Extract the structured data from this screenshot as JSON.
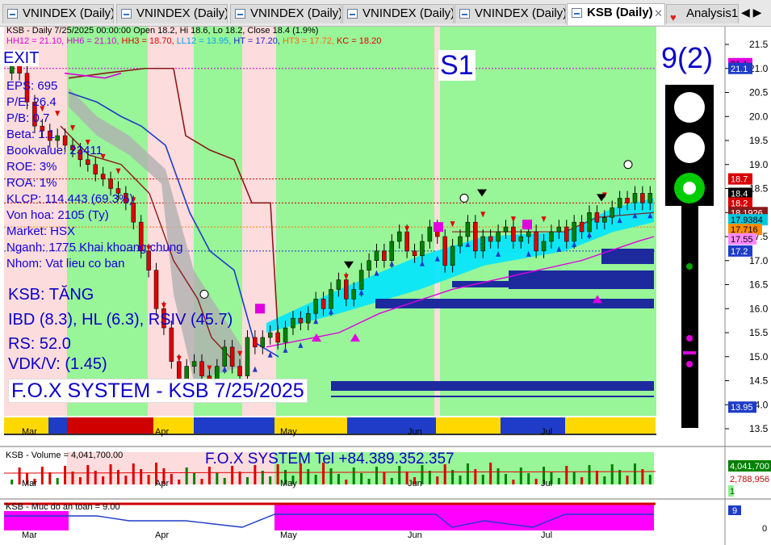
{
  "tabs": [
    {
      "label": "VNINDEX (Daily)",
      "active": false
    },
    {
      "label": "VNINDEX (Daily)",
      "active": false
    },
    {
      "label": "VNINDEX (Daily)",
      "active": false
    },
    {
      "label": "VNINDEX (Daily)",
      "active": false
    },
    {
      "label": "VNINDEX (Daily)",
      "active": false
    },
    {
      "label": "KSB (Daily)",
      "active": true
    },
    {
      "label": "Analysis1",
      "active": false
    }
  ],
  "tab_close": "✕",
  "tab_nav": "◀ ▶",
  "header": {
    "title": "KSB - Daily 7/25/2025 00:00:00 Open 18.2, Hi 18.6, Lo 18.2, Close 18.4 (1.9%)",
    "hh12": "HH12 = 21.10,",
    "hh6": "HH6 = 21.10,",
    "hh3": "HH3 = 18.70,",
    "ll12": "LL12 = 13.95,",
    "ht": "HT  = 17.20,",
    "ht3": "HT3  = 17.72,",
    "kc": "KC = 18.20"
  },
  "overlay": {
    "exit": "EXIT",
    "s1": "S1",
    "signal": "9(2)",
    "eps": "EPS: 695",
    "pe": "P/E: 26.4",
    "pb": "P/B: 0.7",
    "beta": "Beta: 1.1",
    "bookvalue": "Bookvalue: 23411",
    "roe": "ROE: 3%",
    "roa": "ROA: 1%",
    "klcp": "KLCP: 114.443 (69.3%)",
    "vonhoa": "Von hoa: 2105 (Ty)",
    "market": "Market: HSX",
    "nganh": "Nganh: 1775 Khai khoang chung",
    "nhom": "Nhom: Vat lieu co ban",
    "trend": "KSB: TĂNG",
    "ibd": "IBD (8.3), HL (6.3), RSIV (45.7)",
    "rs": "RS: 52.0",
    "vdk": "VDK/V:  (1.45)",
    "fox_title": "F.O.X SYSTEM - KSB 7/25/2025"
  },
  "price_axis": {
    "ticks": [
      "21.5",
      "21.0",
      "20.5",
      "20.0",
      "19.5",
      "19.0",
      "18.5",
      "18.0",
      "17.5",
      "17.0",
      "16.5",
      "16.0",
      "15.5",
      "15.0",
      "14.5",
      "14.0",
      "13.5"
    ],
    "labels": [
      {
        "text": "21.1",
        "bg": "#e000e0",
        "fg": "#000000",
        "price": 21.1
      },
      {
        "text": "21.1",
        "bg": "#1e3cc8",
        "fg": "#ffffff",
        "price": 21.0
      },
      {
        "text": "18.7",
        "bg": "#d80000",
        "fg": "#ffffff",
        "price": 18.7
      },
      {
        "text": "18.4",
        "bg": "#000000",
        "fg": "#ffffff",
        "price": 18.4
      },
      {
        "text": "18.2",
        "bg": "#d80000",
        "fg": "#ffffff",
        "price": 18.2
      },
      {
        "text": "18.1926",
        "bg": "#8b1a1a",
        "fg": "#ffffff",
        "price": 18.0
      },
      {
        "text": "17.9384",
        "bg": "#00c8e0",
        "fg": "#000000",
        "price": 17.85
      },
      {
        "text": "17.716",
        "bg": "#ff8c00",
        "fg": "#000000",
        "price": 17.65
      },
      {
        "text": "17.55",
        "bg": "#ff88ff",
        "fg": "#000000",
        "price": 17.45
      },
      {
        "text": "17.2",
        "bg": "#1e3cc8",
        "fg": "#ffffff",
        "price": 17.2
      },
      {
        "text": "13.95",
        "bg": "#1e3cc8",
        "fg": "#ffffff",
        "price": 13.95
      }
    ]
  },
  "months": [
    "Mar",
    "Apr",
    "May",
    "Jun",
    "Jul"
  ],
  "volume": {
    "title": "KSB - Volume = 4,041,700.00",
    "fox_phone": "F.O.X SYSTEM Tel +84.389.352.357",
    "labels": [
      {
        "text": "4,041,700",
        "bg": "#008000",
        "fg": "#ffffff"
      },
      {
        "text": "2,788,956",
        "bg": "#ffffff",
        "fg": "#c00000"
      },
      {
        "text": "1",
        "bg": "#90ee90",
        "fg": "#006400"
      }
    ]
  },
  "safety": {
    "title": "KSB - Muc do an toan = 9.00",
    "value_label": "9",
    "zero_label": "0"
  },
  "colors": {
    "green_zone": "#98f598",
    "pink_zone": "#fcdcdc",
    "candle_up": "#008000",
    "candle_down": "#dd0000",
    "cyan_band": "#00e5ff",
    "navy": "#1c2a9e"
  },
  "chart_data": {
    "type": "candlestick",
    "title": "KSB - Daily 7/25/2025",
    "ylim": [
      13.3,
      21.7
    ],
    "x_months": [
      "Mar",
      "Apr",
      "May",
      "Jun",
      "Jul"
    ],
    "closes": [
      21.1,
      20.9,
      20.3,
      19.8,
      19.7,
      19.5,
      19.6,
      19.4,
      19.3,
      19.1,
      19.0,
      18.8,
      18.7,
      18.5,
      18.4,
      18.2,
      17.8,
      17.2,
      16.8,
      16.0,
      15.6,
      14.9,
      14.5,
      14.8,
      14.9,
      14.6,
      14.3,
      14.8,
      15.2,
      14.8,
      14.6,
      15.4,
      15.2,
      15.4,
      15.5,
      15.3,
      15.6,
      15.8,
      15.7,
      15.9,
      16.2,
      16.0,
      16.4,
      16.6,
      16.2,
      16.4,
      16.8,
      17.0,
      17.2,
      17.0,
      17.4,
      17.6,
      17.2,
      17.1,
      17.4,
      17.7,
      17.5,
      16.9,
      17.3,
      17.5,
      17.8,
      17.2,
      17.5,
      17.4,
      17.6,
      17.7,
      17.4,
      17.5,
      17.6,
      17.2,
      17.4,
      17.6,
      17.7,
      17.4,
      17.8,
      17.6,
      18.0,
      17.8,
      17.9,
      18.1,
      18.3,
      18.2,
      18.4,
      18.2,
      18.4
    ]
  },
  "lights": [
    "white",
    "white",
    "green"
  ]
}
